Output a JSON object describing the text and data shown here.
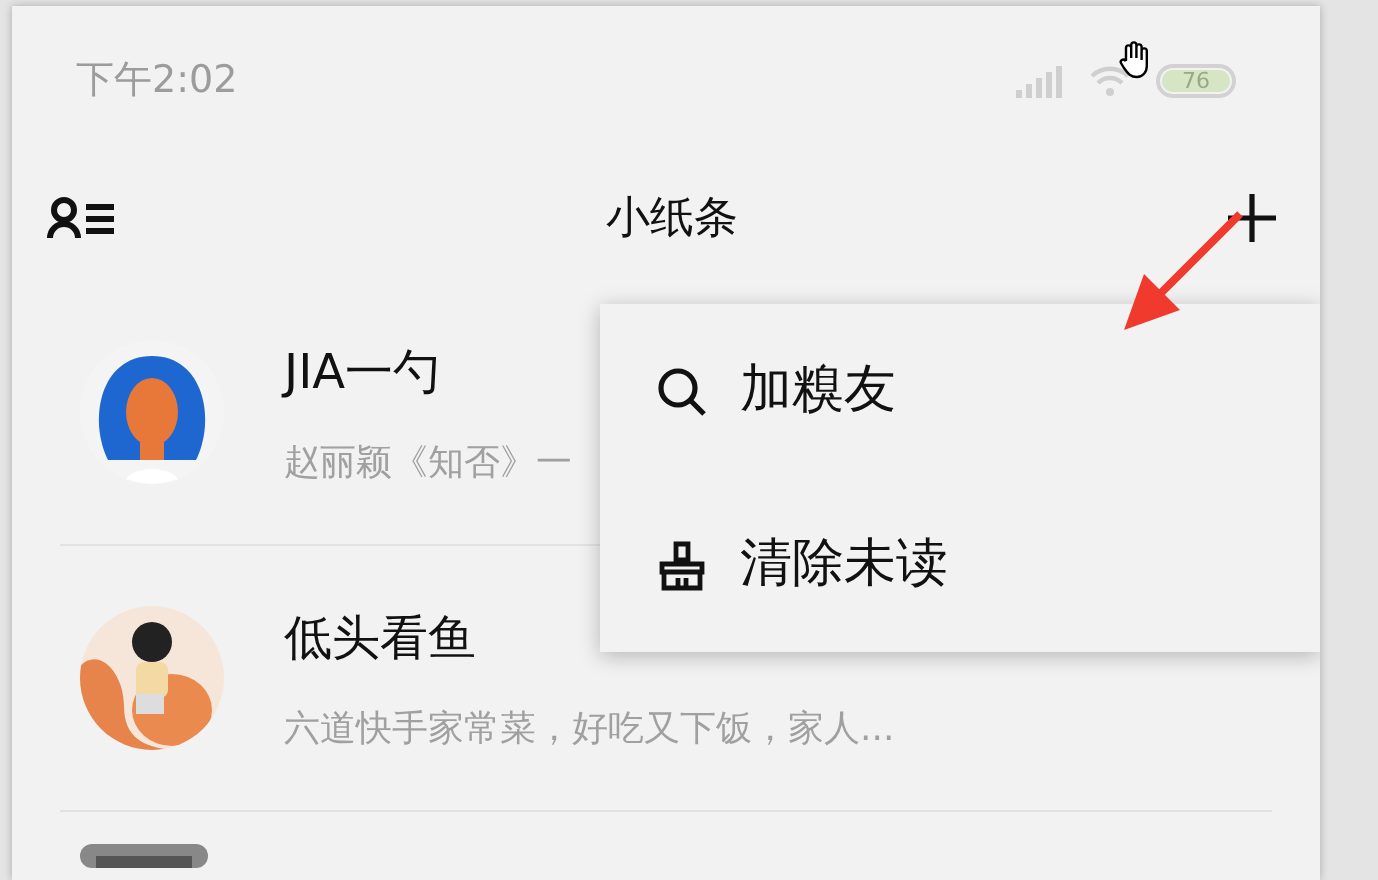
{
  "status_bar": {
    "time": "下午2:02",
    "battery": "76"
  },
  "header": {
    "title": "小纸条"
  },
  "conversations": [
    {
      "name": "JIA一勺",
      "preview": "赵丽颖《知否》一"
    },
    {
      "name": "低头看鱼",
      "preview": "六道快手家常菜，好吃又下饭，家人..."
    }
  ],
  "menu": {
    "items": [
      {
        "kind": "search",
        "label": "加糗友"
      },
      {
        "kind": "clear",
        "label": "清除未读"
      }
    ]
  }
}
